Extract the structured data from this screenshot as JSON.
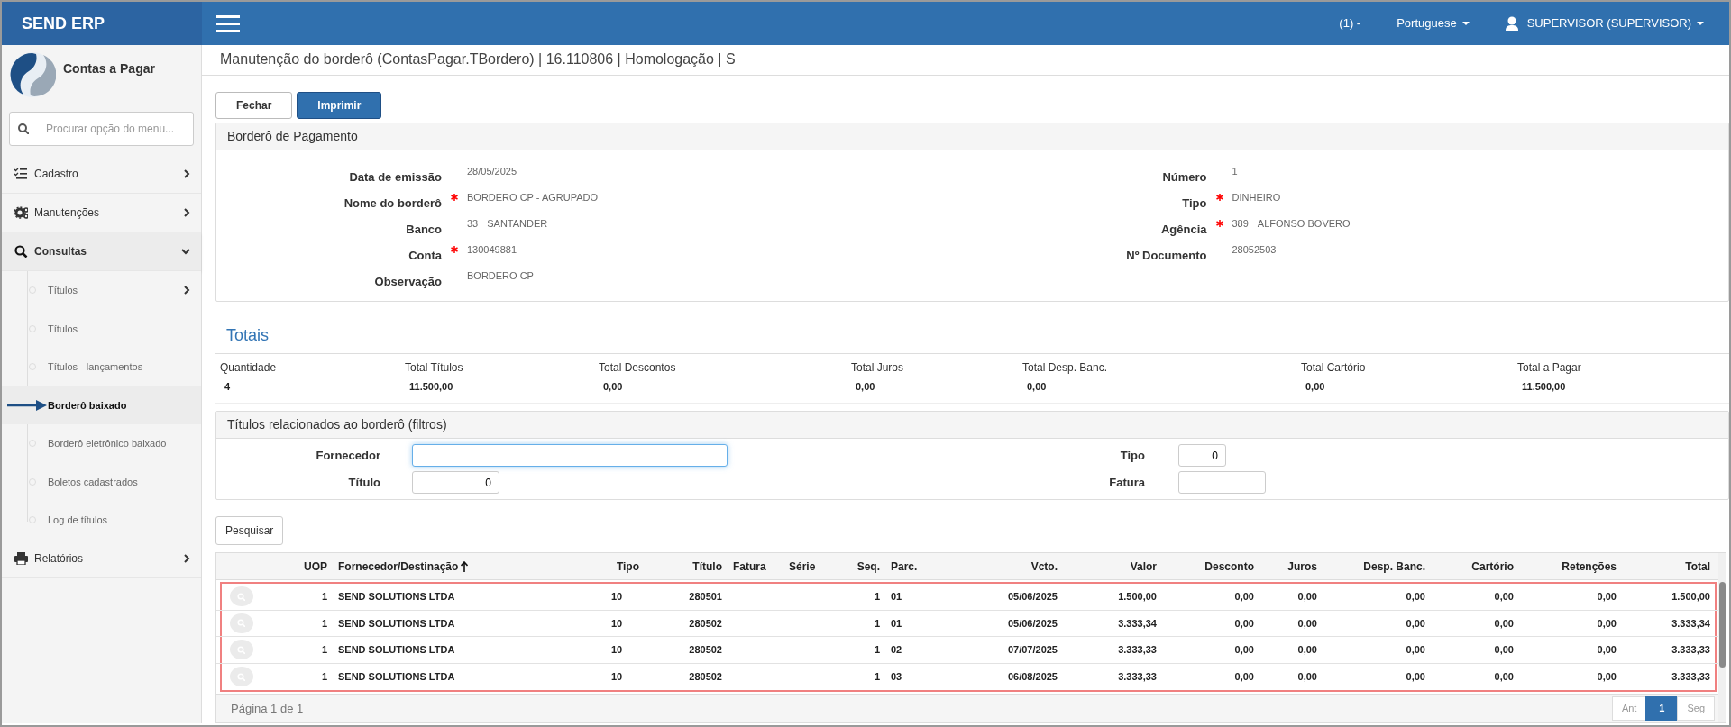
{
  "topbar": {
    "brand": "SEND ERP",
    "company": "(1) -",
    "language": "Portuguese",
    "user": "SUPERVISOR (SUPERVISOR)"
  },
  "sidebar": {
    "module": "Contas a Pagar",
    "search_placeholder": "Procurar opção do menu...",
    "items": [
      {
        "label": "Cadastro",
        "kind": "checklist",
        "expanded": false
      },
      {
        "label": "Manutenções",
        "kind": "gears",
        "expanded": false
      },
      {
        "label": "Consultas",
        "kind": "search",
        "expanded": true,
        "children": [
          {
            "label": "Títulos",
            "has_children": true,
            "selected": false
          },
          {
            "label": "Títulos",
            "has_children": false,
            "selected": false
          },
          {
            "label": "Títulos - lançamentos",
            "has_children": false,
            "selected": false
          },
          {
            "label": "Borderô baixado",
            "has_children": false,
            "selected": true
          },
          {
            "label": "Borderô eletrônico baixado",
            "has_children": false,
            "selected": false
          },
          {
            "label": "Boletos cadastrados",
            "has_children": false,
            "selected": false
          },
          {
            "label": "Log de títulos",
            "has_children": false,
            "selected": false
          }
        ]
      },
      {
        "label": "Relatórios",
        "kind": "printer",
        "expanded": false
      }
    ]
  },
  "page_title": "Manutenção do borderô (ContasPagar.TBordero) | 16.110806 | Homologação | S",
  "buttons": [
    {
      "label": "Fechar",
      "kind": "default"
    },
    {
      "label": "Imprimir",
      "kind": "primary"
    }
  ],
  "bordero": {
    "title": "Borderô de Pagamento",
    "left_fields": [
      {
        "label": "Data de emissão",
        "required": false,
        "value": "28/05/2025"
      },
      {
        "label": "Nome do borderô",
        "required": true,
        "value": "BORDERO CP - AGRUPADO"
      },
      {
        "label": "Banco",
        "required": false,
        "code": "33",
        "value": "SANTANDER"
      },
      {
        "label": "Conta",
        "required": true,
        "value": "130049881"
      },
      {
        "label": "Observação",
        "required": false,
        "value": "BORDERO CP"
      }
    ],
    "right_fields": [
      {
        "label": "Número",
        "required": false,
        "value": "1"
      },
      {
        "label": "Tipo",
        "required": true,
        "value": "DINHEIRO"
      },
      {
        "label": "Agência",
        "required": true,
        "code": "389",
        "value": "ALFONSO BOVERO"
      },
      {
        "label": "Nº Documento",
        "required": false,
        "value": "28052503"
      }
    ]
  },
  "totals": {
    "title": "Totais",
    "items": [
      {
        "label": "Quantidade",
        "value": "4"
      },
      {
        "label": "Total Títulos",
        "value": "11.500,00"
      },
      {
        "label": "Total Descontos",
        "value": "0,00"
      },
      {
        "label": "Total Juros",
        "value": "0,00"
      },
      {
        "label": "Total Desp. Banc.",
        "value": "0,00"
      },
      {
        "label": "Total Cartório",
        "value": "0,00"
      },
      {
        "label": "Total a Pagar",
        "value": "11.500,00"
      }
    ]
  },
  "filters": {
    "title": "Títulos relacionados ao borderô (filtros)",
    "left": [
      {
        "label": "Fornecedor",
        "focused": true
      },
      {
        "label": "Título",
        "value": "0",
        "focused": false
      }
    ],
    "right": [
      {
        "label": "Tipo",
        "value": "0",
        "focused": false
      },
      {
        "label": "Fatura",
        "focused": false
      }
    ]
  },
  "search_button": "Pesquisar",
  "table": {
    "columns": [
      {
        "label": "UOP",
        "sorted": false
      },
      {
        "label": "Fornecedor/Destinação",
        "sorted": true
      },
      {
        "label": "Tipo"
      },
      {
        "label": "Título"
      },
      {
        "label": "Fatura"
      },
      {
        "label": "Série"
      },
      {
        "label": "Seq."
      },
      {
        "label": "Parc."
      },
      {
        "label": "Vcto."
      },
      {
        "label": "Valor"
      },
      {
        "label": "Desconto"
      },
      {
        "label": "Juros"
      },
      {
        "label": "Desp. Banc."
      },
      {
        "label": "Cartório"
      },
      {
        "label": "Retenções"
      },
      {
        "label": "Total"
      }
    ],
    "rows": [
      {
        "uop": "1",
        "fornecedor": "SEND SOLUTIONS LTDA",
        "tipo": "10",
        "titulo": "280501",
        "seq": "1",
        "parc": "01",
        "vcto": "05/06/2025",
        "valor": "1.500,00",
        "desconto": "0,00",
        "juros": "0,00",
        "desp_banc": "0,00",
        "cartorio": "0,00",
        "retencoes": "0,00",
        "total": "1.500,00"
      },
      {
        "uop": "1",
        "fornecedor": "SEND SOLUTIONS LTDA",
        "tipo": "10",
        "titulo": "280502",
        "seq": "1",
        "parc": "01",
        "vcto": "05/06/2025",
        "valor": "3.333,34",
        "desconto": "0,00",
        "juros": "0,00",
        "desp_banc": "0,00",
        "cartorio": "0,00",
        "retencoes": "0,00",
        "total": "3.333,34"
      },
      {
        "uop": "1",
        "fornecedor": "SEND SOLUTIONS LTDA",
        "tipo": "10",
        "titulo": "280502",
        "seq": "1",
        "parc": "02",
        "vcto": "07/07/2025",
        "valor": "3.333,33",
        "desconto": "0,00",
        "juros": "0,00",
        "desp_banc": "0,00",
        "cartorio": "0,00",
        "retencoes": "0,00",
        "total": "3.333,33"
      },
      {
        "uop": "1",
        "fornecedor": "SEND SOLUTIONS LTDA",
        "tipo": "10",
        "titulo": "280502",
        "seq": "1",
        "parc": "03",
        "vcto": "06/08/2025",
        "valor": "3.333,33",
        "desconto": "0,00",
        "juros": "0,00",
        "desp_banc": "0,00",
        "cartorio": "0,00",
        "retencoes": "0,00",
        "total": "3.333,33"
      }
    ],
    "footer": "Página 1 de 1",
    "pagination": [
      {
        "label": "Ant",
        "selected": false,
        "disabled": true
      },
      {
        "label": "1",
        "selected": true,
        "disabled": false
      },
      {
        "label": "Seg",
        "selected": false,
        "disabled": true
      }
    ]
  }
}
